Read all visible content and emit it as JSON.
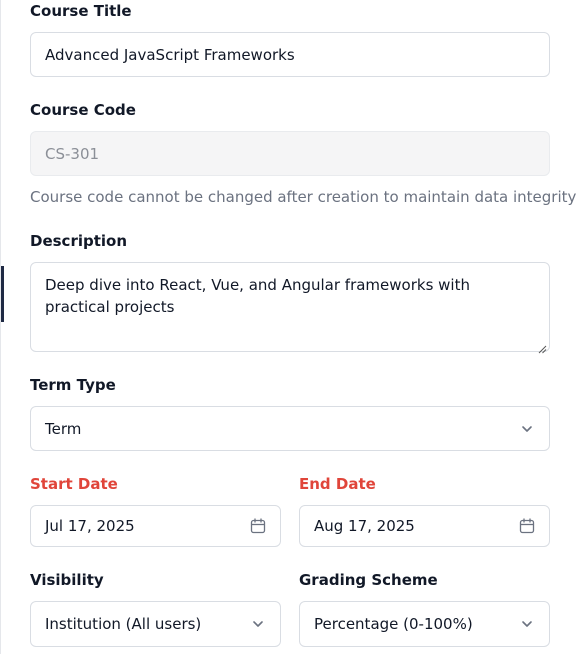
{
  "course_title": {
    "label": "Course Title",
    "value": "Advanced JavaScript Frameworks"
  },
  "course_code": {
    "label": "Course Code",
    "value": "CS-301",
    "help": "Course code cannot be changed after creation to maintain data integrity"
  },
  "description": {
    "label": "Description",
    "value": "Deep dive into React, Vue, and Angular frameworks with practical projects"
  },
  "term_type": {
    "label": "Term Type",
    "value": "Term",
    "icon": "chevron-down-icon"
  },
  "start_date": {
    "label": "Start Date",
    "value": "Jul 17, 2025",
    "icon": "calendar-icon"
  },
  "end_date": {
    "label": "End Date",
    "value": "Aug 17, 2025",
    "icon": "calendar-icon"
  },
  "visibility": {
    "label": "Visibility",
    "value": "Institution (All users)",
    "icon": "chevron-down-icon"
  },
  "grading_scheme": {
    "label": "Grading Scheme",
    "value": "Percentage (0-100%)",
    "icon": "chevron-down-icon"
  },
  "colors": {
    "required_label": "#e0453a",
    "border": "#d9dde3",
    "disabled_bg": "#f5f5f6"
  }
}
